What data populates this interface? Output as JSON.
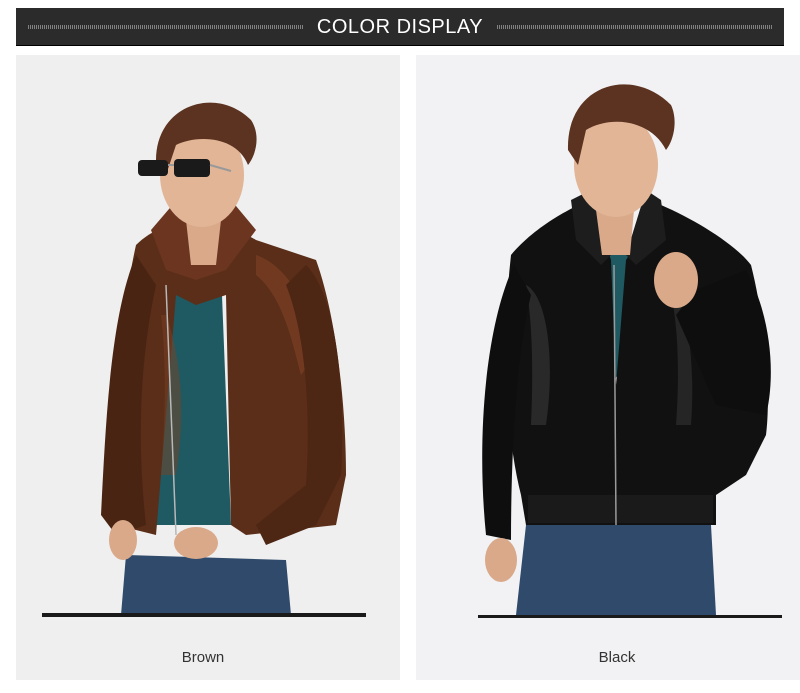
{
  "header": {
    "title": "COLOR DISPLAY"
  },
  "variants": [
    {
      "label": "Brown",
      "jacket_color": "#5a2e18"
    },
    {
      "label": "Black",
      "jacket_color": "#111111"
    }
  ],
  "colors": {
    "header_bg": "#2b2b2b",
    "panel_bg": "#efefef",
    "shirt": "#1f5a63",
    "jeans": "#2f4a6b"
  }
}
